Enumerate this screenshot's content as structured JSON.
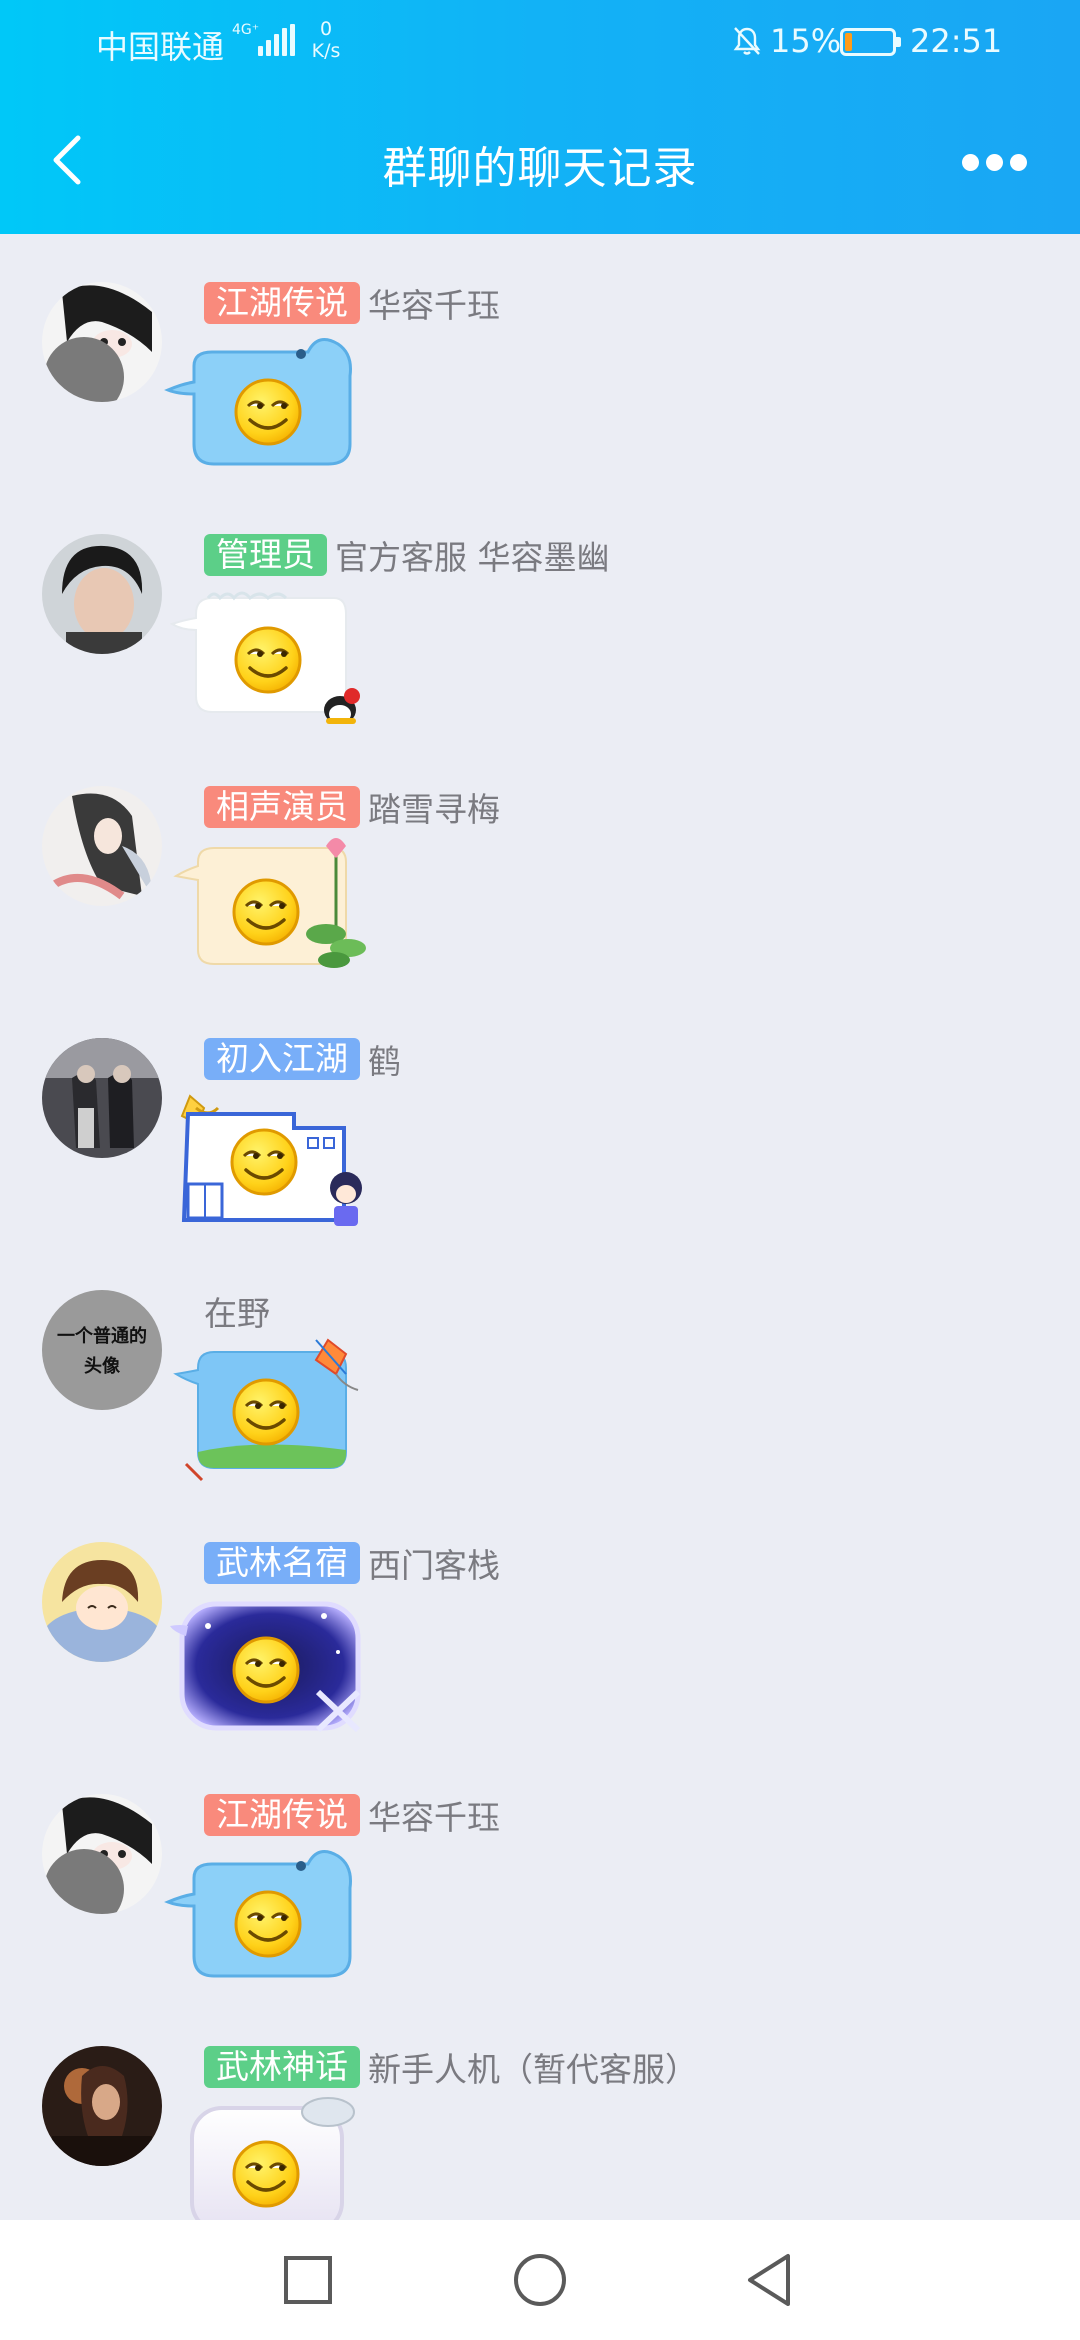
{
  "status_bar": {
    "carrier": "中国联通",
    "network": "4G⁺",
    "speed_value": "0",
    "speed_unit": "K/s",
    "battery_percent": "15%",
    "battery_level": 0.15,
    "battery_fill_color": "#ff9c1a",
    "time": "22:51"
  },
  "header": {
    "title": "群聊的聊天记录",
    "back_icon": "chevron-left-icon",
    "more_icon": "more-dots-icon",
    "gradient": [
      "#00c8f8",
      "#1aa6f4"
    ]
  },
  "messages": [
    {
      "badge": "江湖传说",
      "badge_color": "#f98a7c",
      "sender": "华容千珏",
      "emoji": "smile-face",
      "bubble_style": "blue-whale"
    },
    {
      "badge": "管理员",
      "badge_color": "#5ccf88",
      "sender": "官方客服  华容墨幽",
      "emoji": "smile-face",
      "bubble_style": "snowy-white"
    },
    {
      "badge": "相声演员",
      "badge_color": "#f98a7c",
      "sender": "踏雪寻梅",
      "emoji": "smile-face",
      "bubble_style": "lotus-cream"
    },
    {
      "badge": "初入江湖",
      "badge_color": "#78aef8",
      "sender": "鹤",
      "emoji": "smile-face",
      "bubble_style": "house-outline"
    },
    {
      "badge": "",
      "badge_color": "",
      "sender": "在野",
      "emoji": "smile-face",
      "bubble_style": "kite-sky",
      "avatar_text_line1": "一个普通的",
      "avatar_text_line2": "头像"
    },
    {
      "badge": "武林名宿",
      "badge_color": "#78aef8",
      "sender": "西门客栈",
      "emoji": "smile-face",
      "bubble_style": "night-glow"
    },
    {
      "badge": "江湖传说",
      "badge_color": "#f98a7c",
      "sender": "华容千珏",
      "emoji": "smile-face",
      "bubble_style": "blue-whale"
    },
    {
      "badge": "武林神话",
      "badge_color": "#5ccf88",
      "sender": "新手人机（暂代客服）",
      "emoji": "smile-face",
      "bubble_style": "glossy-white"
    }
  ],
  "nav_bar": {
    "recent_icon": "square-recent-icon",
    "home_icon": "circle-home-icon",
    "back_icon": "triangle-back-icon"
  }
}
